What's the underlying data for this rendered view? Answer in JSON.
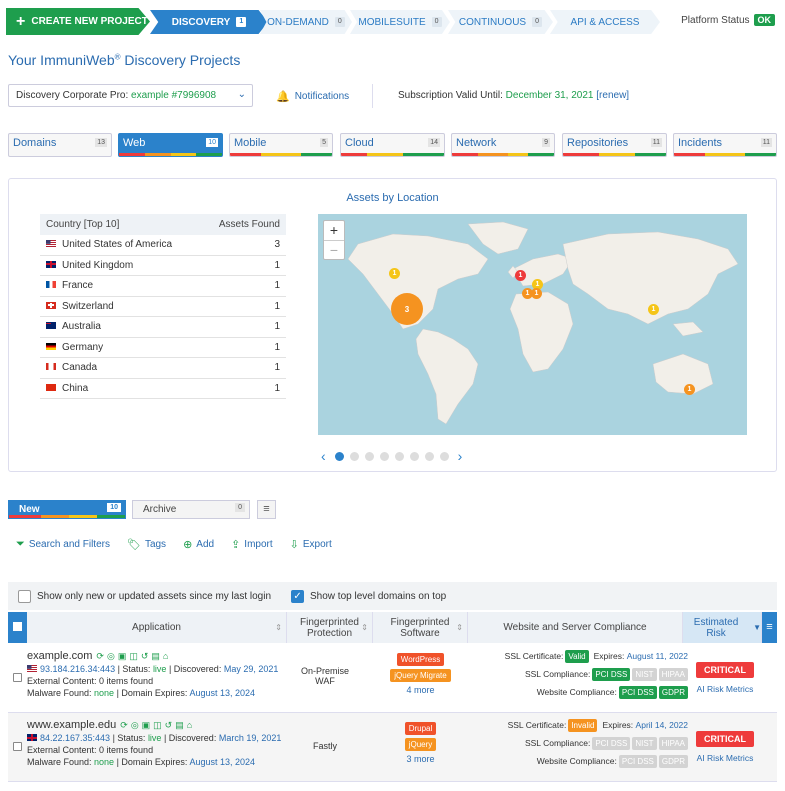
{
  "topbar": {
    "create_label": "CREATE NEW PROJECT",
    "tabs": [
      {
        "label": "DISCOVERY",
        "count": "1"
      },
      {
        "label": "ON-DEMAND",
        "count": "0"
      },
      {
        "label": "MOBILESUITE",
        "count": "0"
      },
      {
        "label": "CONTINUOUS",
        "count": "0"
      },
      {
        "label": "API & ACCESS"
      }
    ],
    "platform_label": "Platform Status",
    "platform_status": "OK"
  },
  "page": {
    "title": "Your ImmuniWeb",
    "title_reg": "®",
    "title_rest": " Discovery Projects",
    "project_select_prefix": "Discovery Corporate Pro: ",
    "project_select_value": "example #7996908",
    "notifications_label": "Notifications",
    "subscription_label": "Subscription Valid Until: ",
    "subscription_date": "December 31, 2021",
    "renew_label": "[renew]"
  },
  "categories": [
    {
      "label": "Domains",
      "count": "13",
      "bar": []
    },
    {
      "label": "Web",
      "count": "10",
      "bar": [
        {
          "c": "#ee3b3b",
          "w": 25
        },
        {
          "c": "#f59320",
          "w": 25
        },
        {
          "c": "#f5c518",
          "w": 25
        },
        {
          "c": "#1e9e4d",
          "w": 25
        }
      ]
    },
    {
      "label": "Mobile",
      "count": "5",
      "bar": [
        {
          "c": "#ee3b3b",
          "w": 30
        },
        {
          "c": "#f5c518",
          "w": 40
        },
        {
          "c": "#1e9e4d",
          "w": 30
        }
      ]
    },
    {
      "label": "Cloud",
      "count": "14",
      "bar": [
        {
          "c": "#ee3b3b",
          "w": 25
        },
        {
          "c": "#f5c518",
          "w": 35
        },
        {
          "c": "#1e9e4d",
          "w": 40
        }
      ]
    },
    {
      "label": "Network",
      "count": "9",
      "bar": [
        {
          "c": "#ee3b3b",
          "w": 25
        },
        {
          "c": "#f59320",
          "w": 30
        },
        {
          "c": "#f5c518",
          "w": 20
        },
        {
          "c": "#1e9e4d",
          "w": 25
        }
      ]
    },
    {
      "label": "Repositories",
      "count": "11",
      "bar": [
        {
          "c": "#ee3b3b",
          "w": 35
        },
        {
          "c": "#f5c518",
          "w": 35
        },
        {
          "c": "#1e9e4d",
          "w": 30
        }
      ]
    },
    {
      "label": "Incidents",
      "count": "11",
      "bar": [
        {
          "c": "#ee3b3b",
          "w": 30
        },
        {
          "c": "#f5c518",
          "w": 40
        },
        {
          "c": "#1e9e4d",
          "w": 30
        }
      ]
    }
  ],
  "location": {
    "title": "Assets by Location",
    "col_country": "Country [Top 10]",
    "col_assets": "Assets Found",
    "rows": [
      {
        "country": "United States of America",
        "count": "3",
        "flag": "us"
      },
      {
        "country": "United Kingdom",
        "count": "1",
        "flag": "uk"
      },
      {
        "country": "France",
        "count": "1",
        "flag": "fr"
      },
      {
        "country": "Switzerland",
        "count": "1",
        "flag": "ch"
      },
      {
        "country": "Australia",
        "count": "1",
        "flag": "au"
      },
      {
        "country": "Germany",
        "count": "1",
        "flag": "de"
      },
      {
        "country": "Canada",
        "count": "1",
        "flag": "ca"
      },
      {
        "country": "China",
        "count": "1",
        "flag": "cn"
      }
    ],
    "map_markers": [
      "1",
      "3",
      "1",
      "1",
      "1",
      "1",
      "1",
      "1"
    ],
    "zoom_in": "+",
    "zoom_out": "−"
  },
  "assets_tabs": [
    {
      "label": "New",
      "count": "10"
    },
    {
      "label": "Archive",
      "count": "0"
    }
  ],
  "tools": [
    "Search and Filters",
    "Tags",
    "Add",
    "Import",
    "Export"
  ],
  "filters": {
    "only_new": "Show only new or updated assets since my last login",
    "top_level": "Show top level domains on top"
  },
  "table": {
    "headers": {
      "application": "Application",
      "protection": "Fingerprinted Protection",
      "software": "Fingerprinted Software",
      "compliance": "Website and Server Compliance",
      "risk": "Estimated Risk"
    },
    "rows": [
      {
        "domain": "example.com",
        "ip": "93.184.216.34:443",
        "status_label": "Status: ",
        "status": "live",
        "discovered_label": "Discovered: ",
        "discovered": "May 29, 2021",
        "external": "External Content: 0 items found",
        "malware_label": "Malware Found: ",
        "malware": "none",
        "expires_label": "Domain Expires: ",
        "expires": "August 13, 2024",
        "protection": "On-Premise WAF",
        "software": [
          "WordPress",
          "jQuery Migrate"
        ],
        "more": "4 more",
        "ssl_label": "SSL Certificate:",
        "ssl_status": "Valid",
        "ssl_expires_label": "Expires:",
        "ssl_expires": "August 11, 2022",
        "ssl_compliance_label": "SSL Compliance:",
        "web_compliance_label": "Website Compliance:",
        "risk": "CRITICAL",
        "ai_label": "AI Risk Metrics"
      },
      {
        "domain": "www.example.edu",
        "ip": "84.22.167.35:443",
        "status_label": "Status: ",
        "status": "live",
        "discovered_label": "Discovered: ",
        "discovered": "March 19, 2021",
        "external": "External Content: 0 items found",
        "malware_label": "Malware Found: ",
        "malware": "none",
        "expires_label": "Domain Expires: ",
        "expires": "August 13, 2024",
        "protection": "Fastly",
        "software": [
          "Drupal",
          "jQuery"
        ],
        "more": "3 more",
        "ssl_label": "SSL Certificate:",
        "ssl_status": "Invalid",
        "ssl_expires_label": "Expires:",
        "ssl_expires": "April 14, 2022",
        "ssl_compliance_label": "SSL Compliance:",
        "web_compliance_label": "Website Compliance:",
        "risk": "CRITICAL",
        "ai_label": "AI Risk Metrics"
      }
    ],
    "badges": {
      "pci": "PCI DSS",
      "nist": "NIST",
      "hipaa": "HIPAA",
      "gdpr": "GDPR"
    }
  }
}
